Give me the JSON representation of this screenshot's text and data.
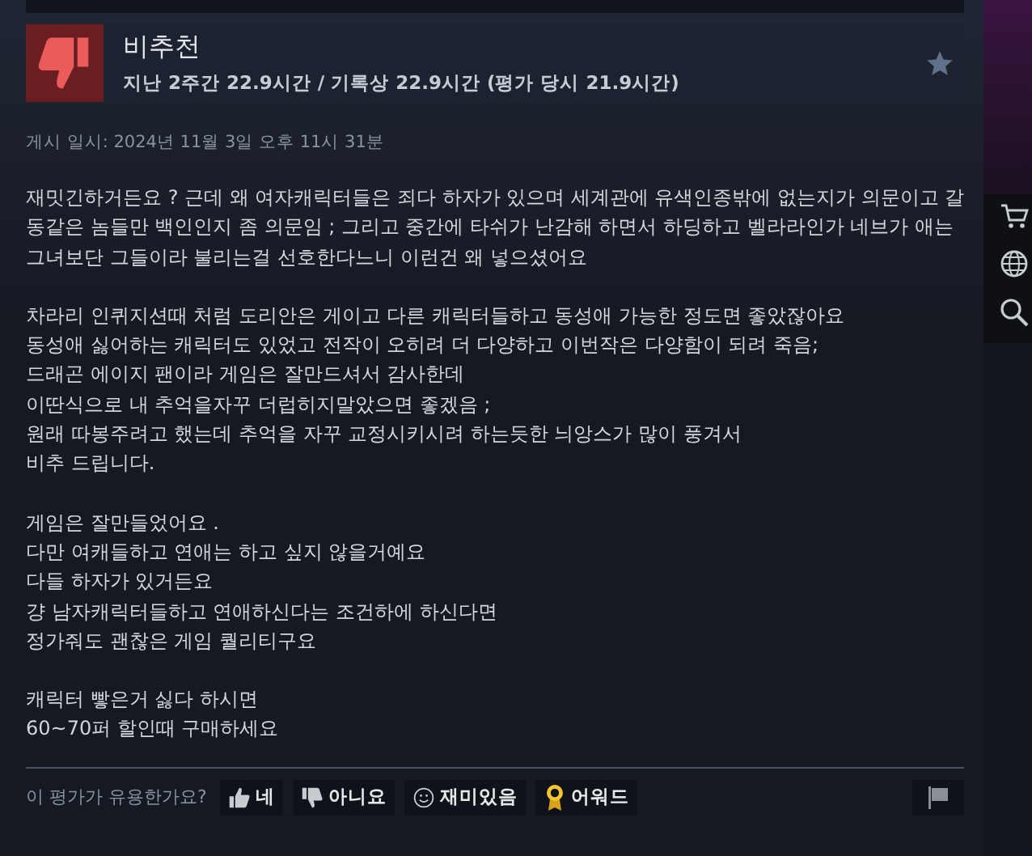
{
  "review": {
    "verdict": "비추천",
    "hours": "지난 2주간 22.9시간 / 기록상 22.9시간 (평가 당시 21.9시간)",
    "posted": "게시 일시: 2024년 11월 3일 오후 11시 31분",
    "paragraphs": [
      [
        "재밋긴하거든요 ? 근데 왜 여자캐릭터들은 죄다 하자가 있으며 세계관에 유색인종밖에 없는지가 의문이고 갈",
        "동같은 놈들만 백인인지 좀 의문임 ; 그리고 중간에 타쉬가 난감해 하면서 하딩하고 벨라라인가 네브가 애는",
        "그녀보단 그들이라 불리는걸 선호한다느니 이런건 왜 넣으셨어요"
      ],
      [
        "차라리 인퀴지션때 처럼 도리안은 게이고 다른 캐릭터들하고 동성애 가능한 정도면 좋았잖아요",
        "동성애 싫어하는 캐릭터도 있었고 전작이 오히려 더 다양하고 이번작은 다양함이 되려 죽음;",
        "드래곤 에이지 팬이라 게임은 잘만드셔서 감사한데",
        "이딴식으로 내 추억을자꾸 더럽히지말았으면 좋겠음 ;",
        "원래 따봉주려고 했는데 추억을 자꾸 교정시키시려 하는듯한 늬앙스가 많이 풍겨서",
        "비추 드립니다."
      ],
      [
        "게임은 잘만들었어요 .",
        "다만 여캐들하고 연애는 하고 싶지 않을거예요",
        "다들 하자가 있거든요",
        "걍 남자캐릭터들하고 연애하신다는 조건하에 하신다면",
        "정가줘도 괜찮은 게임 퀄리티구요"
      ],
      [
        "캐릭터 빻은거 싫다 하시면",
        "60~70퍼 할인때 구매하세요"
      ]
    ]
  },
  "footer": {
    "question": "이 평가가 유용한가요?",
    "buttons": [
      {
        "kind": "yes",
        "label": "네"
      },
      {
        "kind": "no",
        "label": "아니요"
      },
      {
        "kind": "funny",
        "label": "재미있음"
      },
      {
        "kind": "award",
        "label": "어워드"
      }
    ]
  }
}
